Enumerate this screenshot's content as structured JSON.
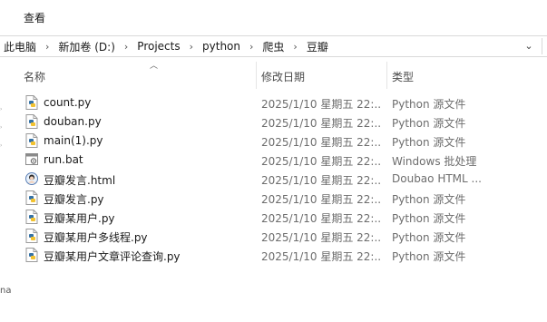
{
  "menu": {
    "view_label": "查看"
  },
  "address": {
    "segments": [
      "此电脑",
      "新加卷 (D:)",
      "Projects",
      "python",
      "爬虫",
      "豆瓣"
    ],
    "separator": "›"
  },
  "sidebar": {
    "partial_label": "na"
  },
  "columns": {
    "name": "名称",
    "date": "修改日期",
    "type": "类型"
  },
  "files": [
    {
      "name": "count.py",
      "date": "2025/1/10 星期五 22:...",
      "type": "Python 源文件",
      "icon": "python-file-icon"
    },
    {
      "name": "douban.py",
      "date": "2025/1/10 星期五 22:...",
      "type": "Python 源文件",
      "icon": "python-file-icon"
    },
    {
      "name": "main(1).py",
      "date": "2025/1/10 星期五 22:...",
      "type": "Python 源文件",
      "icon": "python-file-icon"
    },
    {
      "name": "run.bat",
      "date": "2025/1/10 星期五 22:...",
      "type": "Windows 批处理",
      "icon": "batch-file-icon"
    },
    {
      "name": "豆瓣发言.html",
      "date": "2025/1/10 星期五 22:...",
      "type": "Doubao HTML ...",
      "icon": "html-file-icon"
    },
    {
      "name": "豆瓣发言.py",
      "date": "2025/1/10 星期五 22:...",
      "type": "Python 源文件",
      "icon": "python-file-icon"
    },
    {
      "name": "豆瓣某用户.py",
      "date": "2025/1/10 星期五 22:...",
      "type": "Python 源文件",
      "icon": "python-file-icon"
    },
    {
      "name": "豆瓣某用户多线程.py",
      "date": "2025/1/10 星期五 22:...",
      "type": "Python 源文件",
      "icon": "python-file-icon"
    },
    {
      "name": "豆瓣某用户文章评论查询.py",
      "date": "2025/1/10 星期五 22:...",
      "type": "Python 源文件",
      "icon": "python-file-icon"
    }
  ],
  "colors": {
    "python_icon": "#3572a5",
    "accent": "#0078d4"
  }
}
